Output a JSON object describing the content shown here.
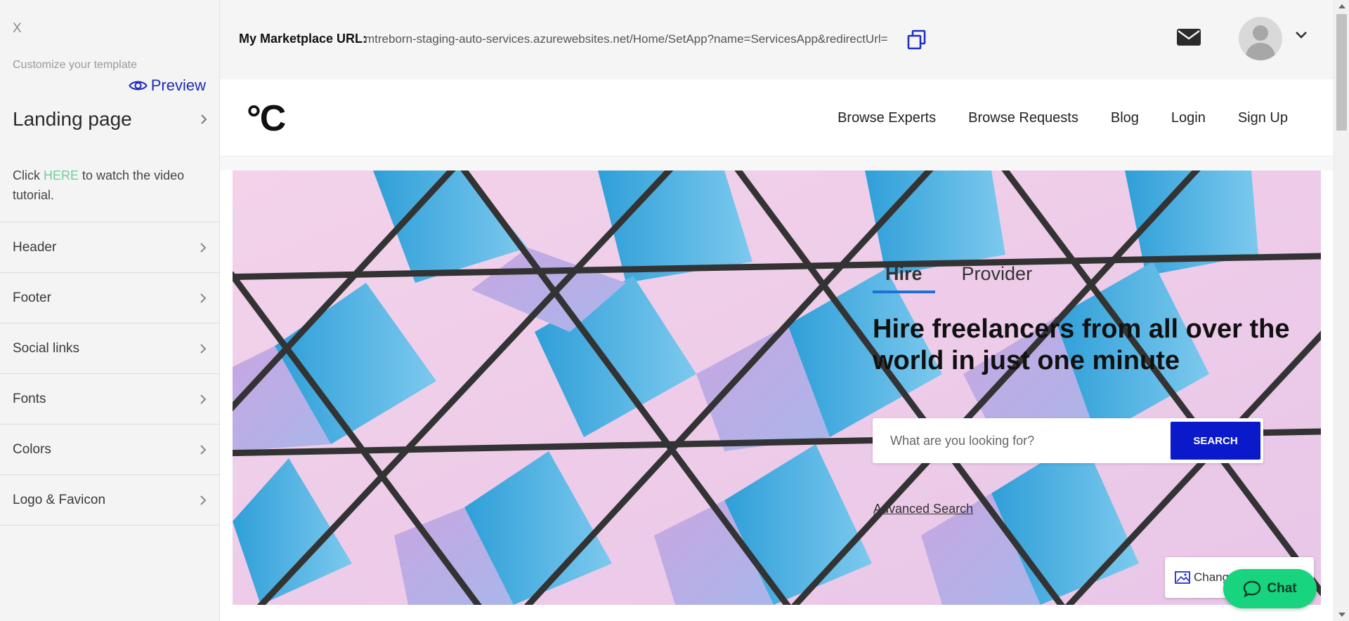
{
  "sidebar": {
    "close_label": "X",
    "caption": "Customize your template",
    "preview_label": "Preview",
    "landing_label": "Landing page",
    "tutorial": {
      "prefix": "Click ",
      "link": "HERE",
      "suffix": " to watch the video tutorial."
    },
    "items": [
      {
        "label": "Header"
      },
      {
        "label": "Footer"
      },
      {
        "label": "Social links"
      },
      {
        "label": "Fonts"
      },
      {
        "label": "Colors"
      },
      {
        "label": "Logo & Favicon"
      }
    ]
  },
  "topbar": {
    "url_label": "My Marketplace URL:",
    "url_value": "mtreborn-staging-auto-services.azurewebsites.net/Home/SetApp?name=ServicesApp&redirectUrl="
  },
  "site": {
    "logo_text": "°C",
    "nav": [
      {
        "label": "Browse Experts"
      },
      {
        "label": "Browse Requests"
      },
      {
        "label": "Blog"
      },
      {
        "label": "Login"
      },
      {
        "label": "Sign Up"
      }
    ]
  },
  "hero": {
    "tabs": [
      {
        "label": "Hire"
      },
      {
        "label": "Provider"
      }
    ],
    "headline": "Hire freelancers from all over the world in just one minute",
    "search_placeholder": "What are you looking for?",
    "search_button": "SEARCH",
    "advanced_search": "Advanced Search",
    "change_label": "Chang"
  },
  "chat": {
    "label": "Chat"
  },
  "colors": {
    "accent_blue": "#0a19c9",
    "preview_blue": "#1e2bb8",
    "tab_underline": "#1f6fd6",
    "here_link": "#6fcf97",
    "chat_green": "#19d47e"
  }
}
